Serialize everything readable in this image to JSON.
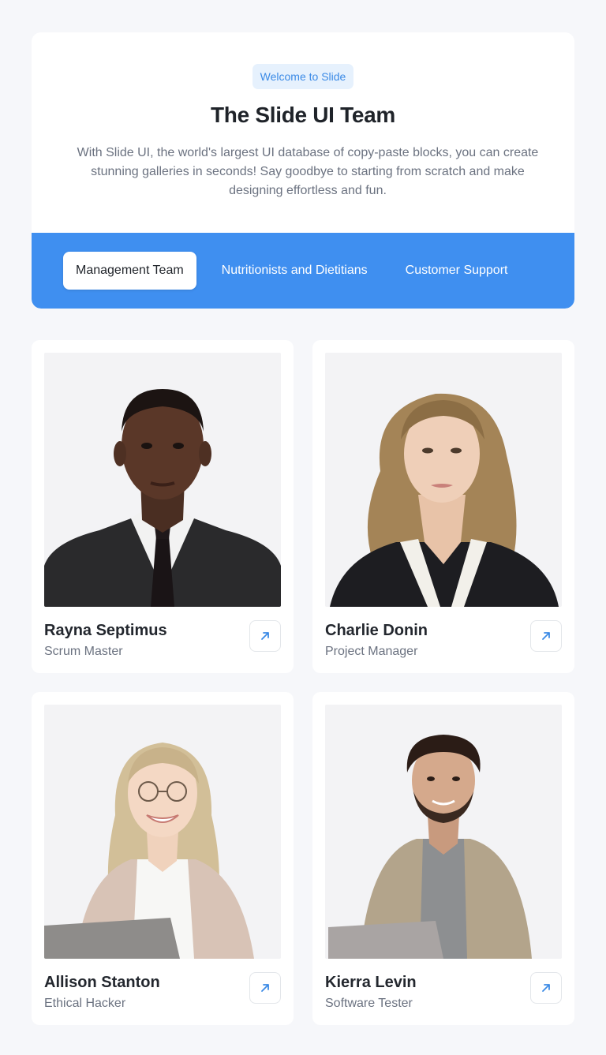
{
  "header": {
    "badge": "Welcome to Slide",
    "title": "The Slide UI Team",
    "description": "With Slide UI, the world's largest UI database of copy-paste blocks, you can create stunning galleries in seconds! Say goodbye to starting from scratch and make designing effortless and fun."
  },
  "tabs": [
    {
      "label": "Management Team",
      "active": true
    },
    {
      "label": "Nutritionists and Dietitians",
      "active": false
    },
    {
      "label": "Customer Support",
      "active": false
    }
  ],
  "members": [
    {
      "name": "Rayna Septimus",
      "role": "Scrum Master"
    },
    {
      "name": "Charlie Donin",
      "role": "Project Manager"
    },
    {
      "name": "Allison Stanton",
      "role": "Ethical Hacker"
    },
    {
      "name": "Kierra Levin",
      "role": "Software Tester"
    }
  ],
  "colors": {
    "accent": "#3f8ff0",
    "badge_bg": "#e6f1fd",
    "badge_text": "#3b8ae6",
    "page_bg": "#f6f7fa"
  }
}
